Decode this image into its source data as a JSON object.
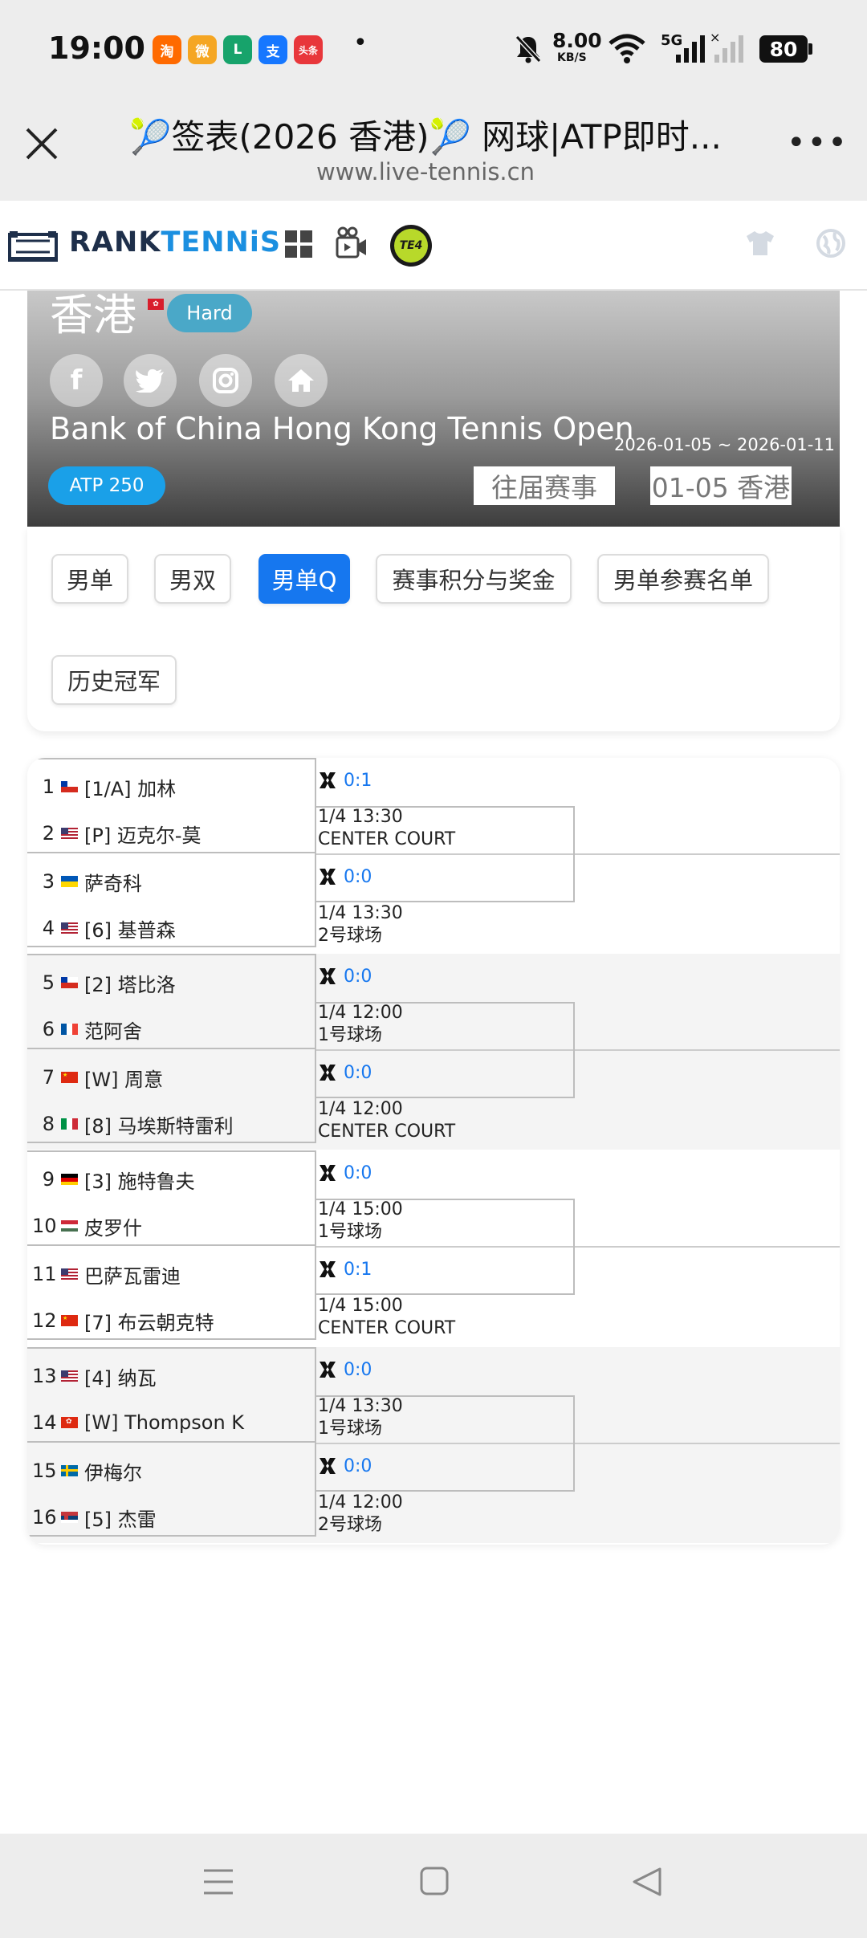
{
  "status_bar": {
    "time": "19:00",
    "apps": [
      {
        "name": "taobao-icon",
        "label": "淘",
        "color": "#ff6a00"
      },
      {
        "name": "weibo-icon",
        "label": "微",
        "color": "#f5a623"
      },
      {
        "name": "green-app-icon",
        "label": "L",
        "color": "#17a36b"
      },
      {
        "name": "alipay-icon",
        "label": "支",
        "color": "#1677ff"
      },
      {
        "name": "toutiao-icon",
        "label": "头条",
        "color": "#e8373b"
      }
    ],
    "net_speed": "8.00",
    "net_unit": "KB/S",
    "signal": "5G",
    "battery": "80"
  },
  "browser": {
    "title": "🎾签表(2026 香港)🎾 网球|ATP即时...",
    "url": "www.live-tennis.cn"
  },
  "site": {
    "brand_prefix": "RANK",
    "brand_suffix": "TENNiS",
    "te_badge": "TE4"
  },
  "tournament": {
    "city": "香港",
    "surface": "Hard",
    "name": "Bank of China Hong Kong Tennis Open",
    "dates": "2026-01-05 ~ 2026-01-11",
    "level": "ATP 250",
    "past_btn": "往届赛事",
    "date_btn": "01-05 香港",
    "social": [
      "facebook-icon",
      "twitter-icon",
      "instagram-icon",
      "home-icon"
    ]
  },
  "tabs": [
    "男单",
    "男双",
    "男单Q",
    "赛事积分与奖金",
    "男单参赛名单",
    "历史冠军"
  ],
  "active_tab": "男单Q",
  "draw": [
    {
      "players": [
        {
          "num": "1",
          "flag": "CL",
          "name": "[1/A] 加林"
        },
        {
          "num": "2",
          "flag": "US",
          "name": "[P] 迈克尔-莫"
        },
        {
          "num": "3",
          "flag": "UA",
          "name": "萨奇科"
        },
        {
          "num": "4",
          "flag": "US",
          "name": "[6] 基普森"
        }
      ],
      "matches": [
        {
          "score": "0:1",
          "time": "1/4 13:30",
          "court": "CENTER COURT"
        },
        {
          "score": "0:0",
          "time": "1/4 13:30",
          "court": "2号球场"
        }
      ]
    },
    {
      "players": [
        {
          "num": "5",
          "flag": "CL",
          "name": "[2] 塔比洛"
        },
        {
          "num": "6",
          "flag": "FR",
          "name": "范阿舍"
        },
        {
          "num": "7",
          "flag": "CN",
          "name": "[W] 周意"
        },
        {
          "num": "8",
          "flag": "IT",
          "name": "[8] 马埃斯特雷利"
        }
      ],
      "matches": [
        {
          "score": "0:0",
          "time": "1/4 12:00",
          "court": "1号球场"
        },
        {
          "score": "0:0",
          "time": "1/4 12:00",
          "court": "CENTER COURT"
        }
      ]
    },
    {
      "players": [
        {
          "num": "9",
          "flag": "DE",
          "name": "[3] 施特鲁夫"
        },
        {
          "num": "10",
          "flag": "HU",
          "name": "皮罗什"
        },
        {
          "num": "11",
          "flag": "US",
          "name": "巴萨瓦雷迪"
        },
        {
          "num": "12",
          "flag": "CN",
          "name": "[7] 布云朝克特"
        }
      ],
      "matches": [
        {
          "score": "0:0",
          "time": "1/4 15:00",
          "court": "1号球场"
        },
        {
          "score": "0:1",
          "time": "1/4 15:00",
          "court": "CENTER COURT"
        }
      ]
    },
    {
      "players": [
        {
          "num": "13",
          "flag": "US",
          "name": "[4] 纳瓦"
        },
        {
          "num": "14",
          "flag": "HK",
          "name": "[W] Thompson K"
        },
        {
          "num": "15",
          "flag": "SE",
          "name": "伊梅尔"
        },
        {
          "num": "16",
          "flag": "RS",
          "name": "[5] 杰雷"
        }
      ],
      "matches": [
        {
          "score": "0:0",
          "time": "1/4 13:30",
          "court": "1号球场"
        },
        {
          "score": "0:0",
          "time": "1/4 12:00",
          "court": "2号球场"
        }
      ]
    }
  ],
  "colors": {
    "active_tab": "#1677ef",
    "atp_badge": "#1aa0e8",
    "surface_badge": "#4aa8c8",
    "score_text": "#1677ef"
  }
}
